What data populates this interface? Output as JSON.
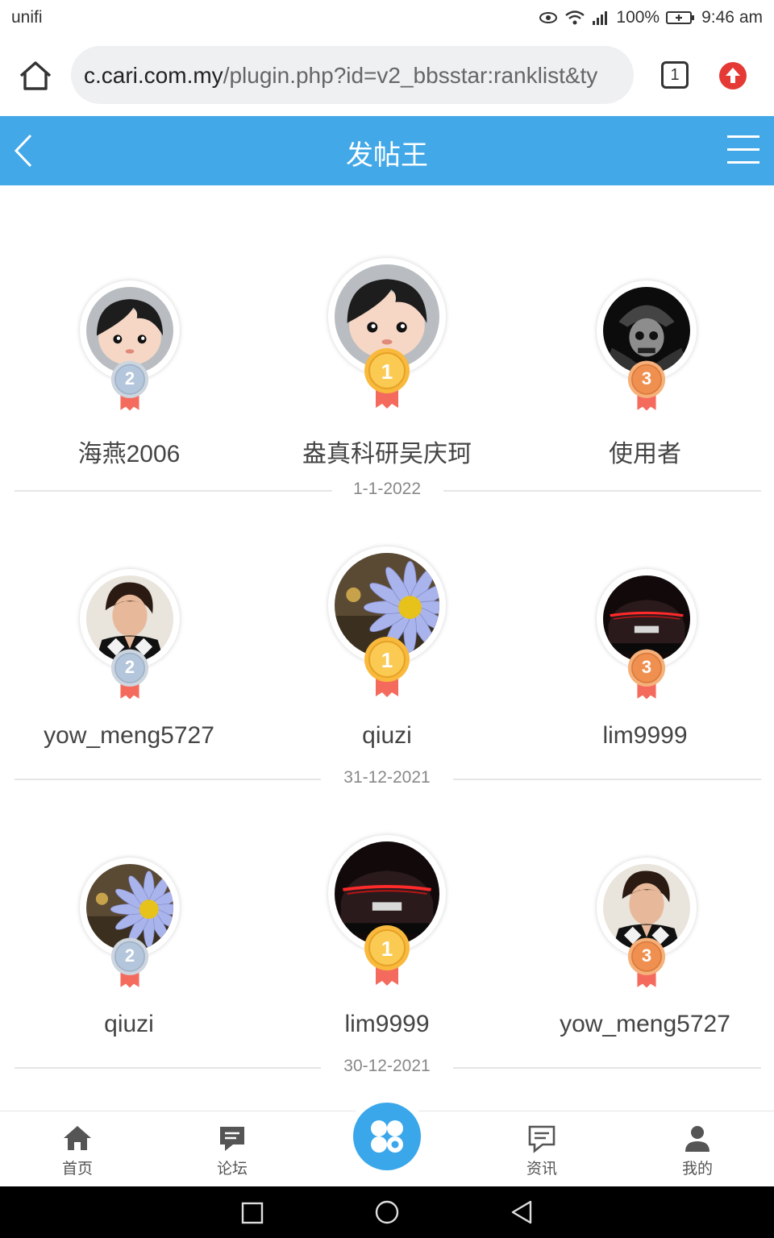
{
  "status_bar": {
    "carrier": "unifi",
    "battery": "100%",
    "time": "9:46 am"
  },
  "browser": {
    "url_host": "c.cari.com.my",
    "url_path": "/plugin.php?id=v2_bbsstar:ranklist&ty",
    "tab_count": "1"
  },
  "header": {
    "title": "发帖王"
  },
  "days": [
    {
      "date": "1-1-2022",
      "first": {
        "name": "盎真科研吴庆珂",
        "avatar": "default-avatar"
      },
      "second": {
        "name": "海燕2006",
        "avatar": "default-avatar"
      },
      "third": {
        "name": "使用者",
        "avatar": "samurai-skull-avatar"
      }
    },
    {
      "date": "31-12-2021",
      "first": {
        "name": "qiuzi",
        "avatar": "daisy-avatar"
      },
      "second": {
        "name": "yow_meng5727",
        "avatar": "portrait-avatar"
      },
      "third": {
        "name": "lim9999",
        "avatar": "car-avatar"
      }
    },
    {
      "date": "30-12-2021",
      "first": {
        "name": "lim9999",
        "avatar": "car-avatar"
      },
      "second": {
        "name": "qiuzi",
        "avatar": "daisy-avatar"
      },
      "third": {
        "name": "yow_meng5727",
        "avatar": "portrait-avatar"
      }
    }
  ],
  "medals": {
    "first": "1",
    "second": "2",
    "third": "3"
  },
  "bottom_nav": {
    "home": "首页",
    "forum": "论坛",
    "news": "资讯",
    "mine": "我的"
  }
}
